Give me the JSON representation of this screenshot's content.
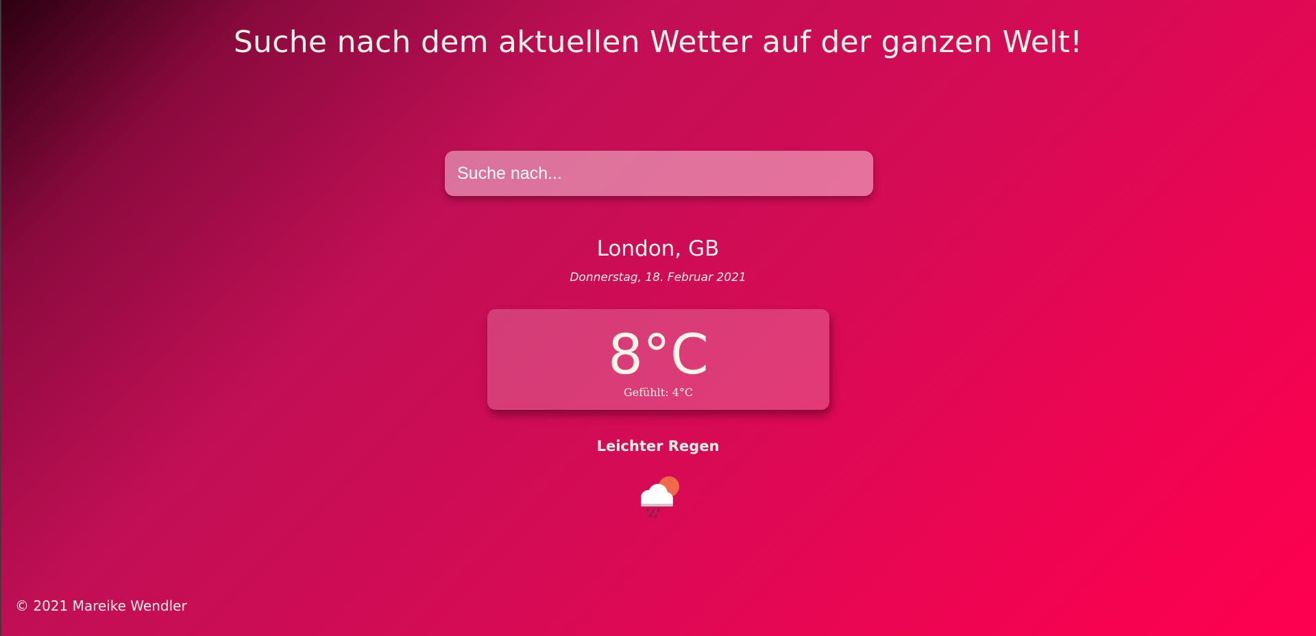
{
  "header": {
    "title": "Suche nach dem aktuellen Wetter auf der ganzen Welt!"
  },
  "search": {
    "placeholder": "Suche nach...",
    "value": ""
  },
  "location": {
    "name": "London, GB",
    "date": "Donnerstag, 18. Februar 2021"
  },
  "weather": {
    "temperature": "8°C",
    "feels_like_label": "Gefühlt:",
    "feels_like_value": "4°C",
    "condition": "Leichter Regen",
    "icon": "cloud-sun-rain-icon"
  },
  "footer": {
    "copyright": "© 2021 Mareike Wendler"
  },
  "colors": {
    "gradient_start": "#2a0010",
    "gradient_mid": "#c10f55",
    "gradient_end": "#ff0050",
    "text": "#fff4e6"
  }
}
